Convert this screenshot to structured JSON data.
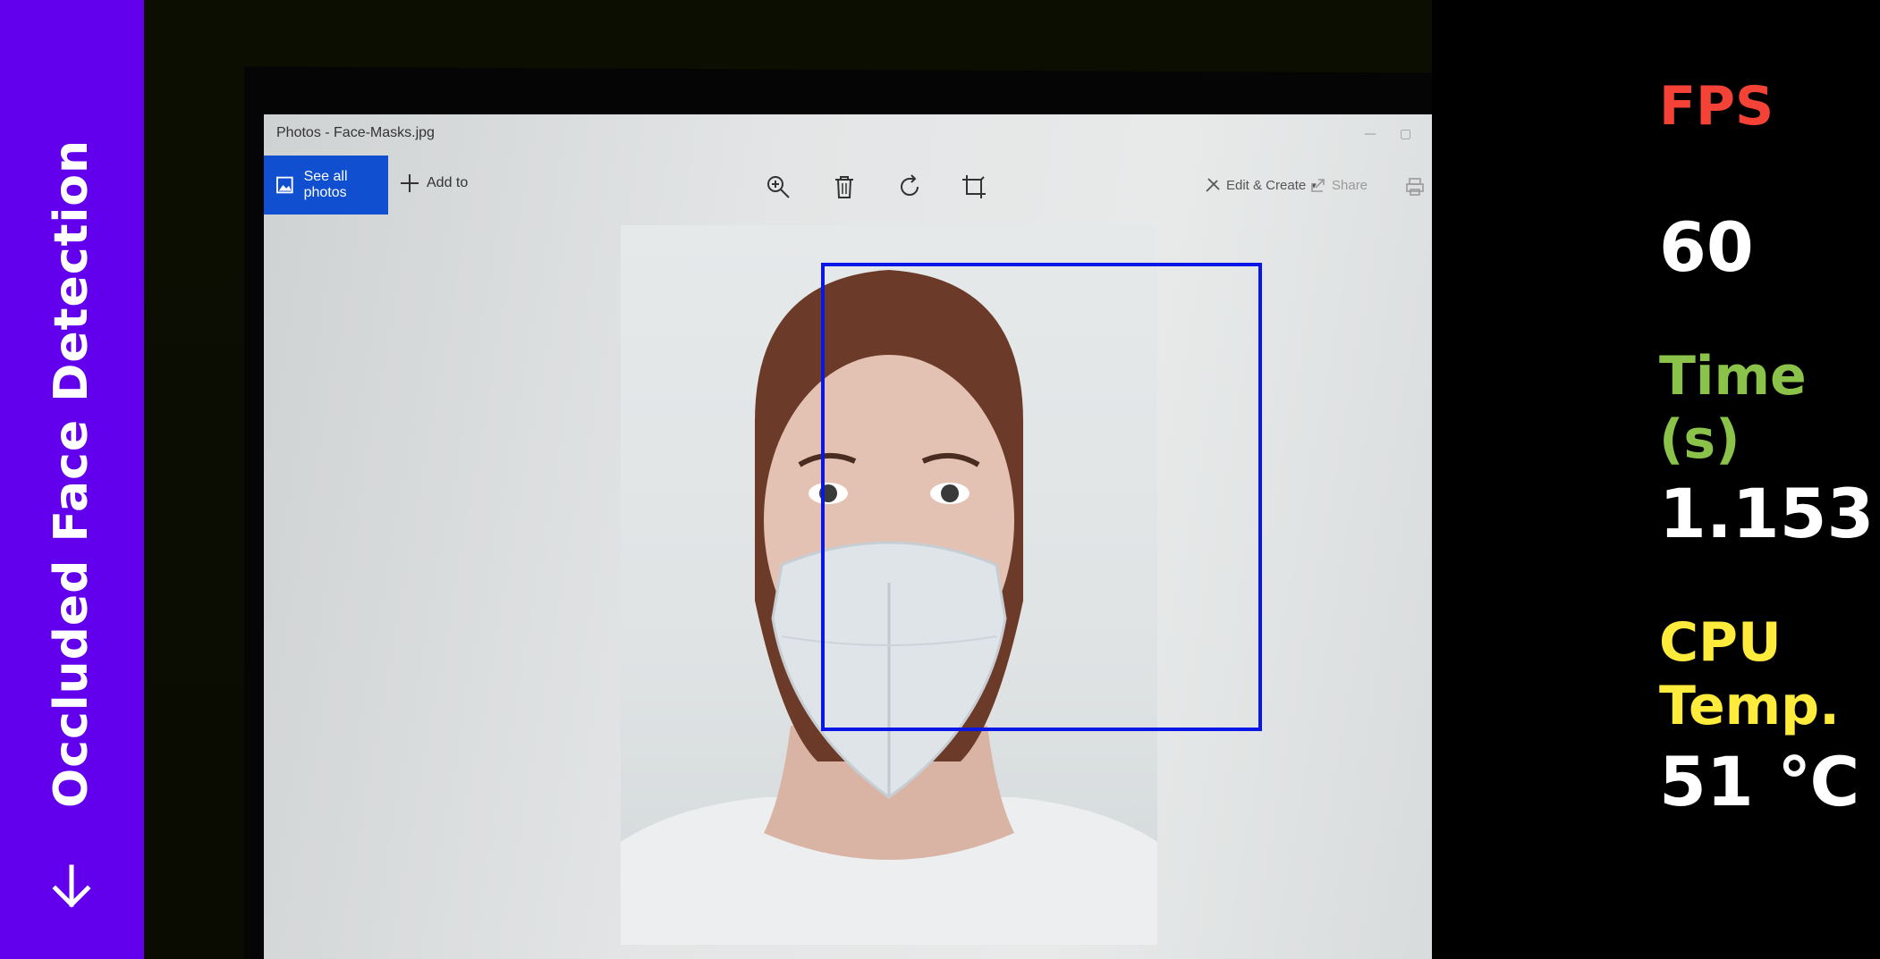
{
  "sidebar": {
    "title": "Occluded Face Detection",
    "arrow_icon": "arrow-down-icon",
    "background": "#6200ee"
  },
  "camera_view": {
    "photos_app": {
      "window_title": "Photos - Face-Masks.jpg",
      "see_all_label": "See all photos",
      "add_to_label": "Add to",
      "edit_create_label": "Edit & Create",
      "share_label": "Share",
      "toolbar_icons": [
        "zoom-in-icon",
        "delete-icon",
        "rotate-icon",
        "crop-icon"
      ]
    },
    "detection_box_color": "#0a16e6"
  },
  "stats": {
    "fps_label": "FPS",
    "fps_value": "60",
    "time_label": "Time(s)",
    "time_value": "1.153",
    "cpu_label": "CPU Temp.",
    "cpu_value": "51 ℃",
    "colors": {
      "fps": "#f44336",
      "time": "#8bc34a",
      "cpu": "#ffeb3b"
    }
  }
}
